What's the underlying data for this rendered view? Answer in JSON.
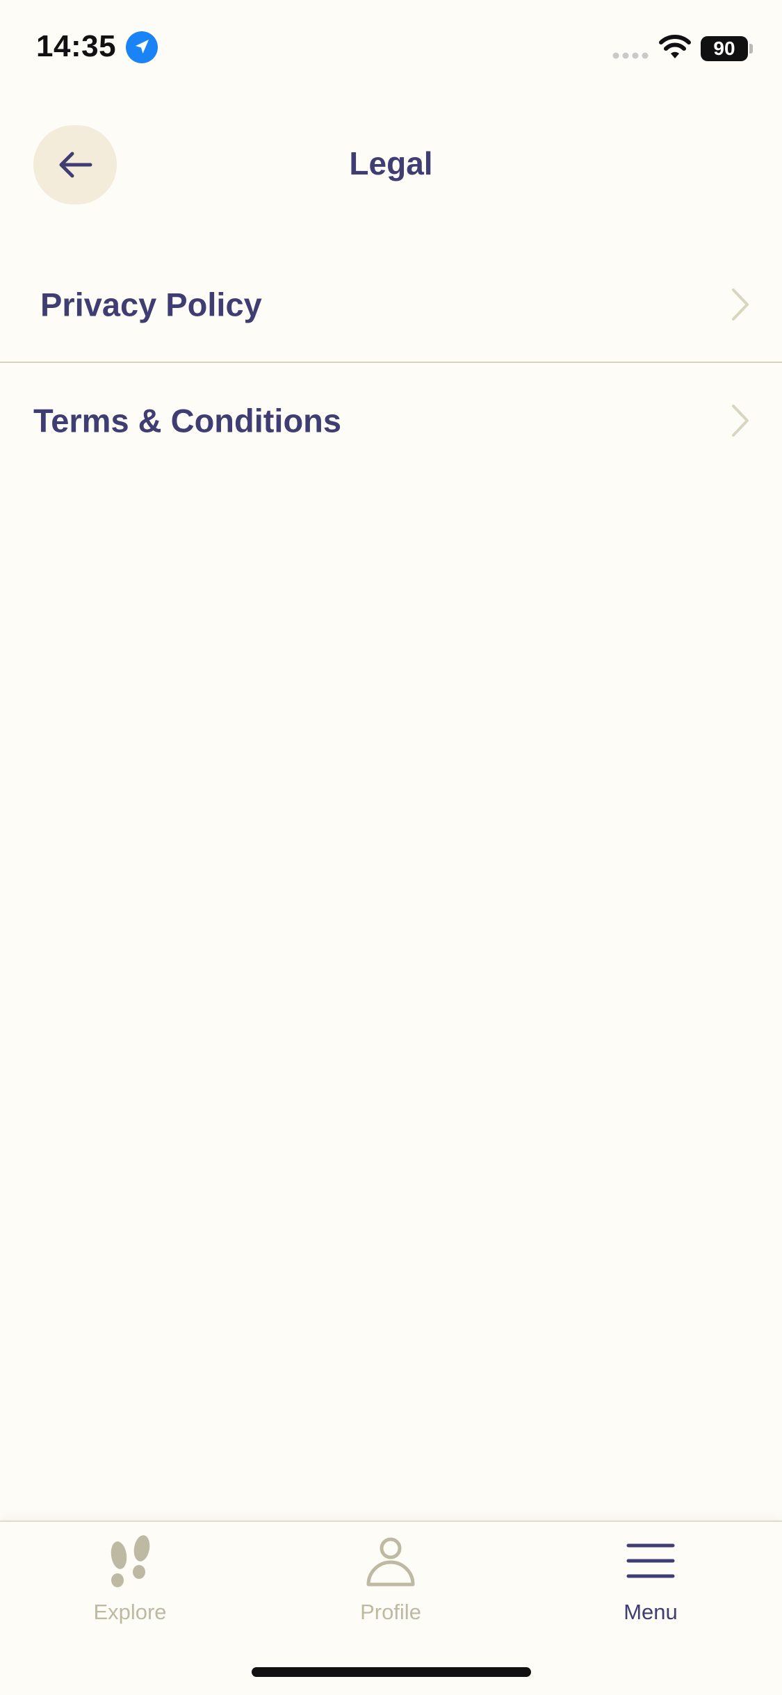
{
  "status_bar": {
    "time": "14:35",
    "battery": "90"
  },
  "header": {
    "title": "Legal"
  },
  "menu": {
    "items": [
      {
        "label": "Privacy Policy"
      },
      {
        "label": "Terms & Conditions"
      }
    ]
  },
  "tab_bar": {
    "tabs": [
      {
        "label": "Explore",
        "icon": "footprints-icon"
      },
      {
        "label": "Profile",
        "icon": "person-icon"
      },
      {
        "label": "Menu",
        "icon": "hamburger-menu-icon"
      }
    ],
    "active": "Menu"
  },
  "colors": {
    "background": "#FEFCF6",
    "primary": "#3F3D72",
    "muted": "#BDB9A2",
    "back_button_bg": "#F3ECDB",
    "location_blue": "#1A84F7"
  }
}
